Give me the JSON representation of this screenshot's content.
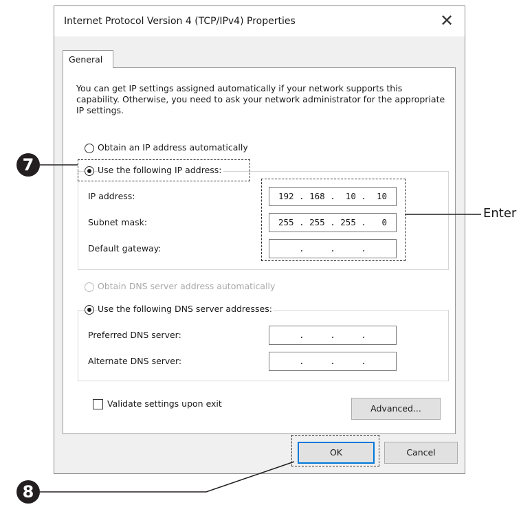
{
  "dialog": {
    "title": "Internet Protocol Version 4 (TCP/IPv4) Properties",
    "close_icon": "close-icon",
    "tab_general": "General",
    "description": "You can get IP settings assigned automatically if your network supports this capability. Otherwise, you need to ask your network administrator for the appropriate IP settings.",
    "ip_section": {
      "obtain_auto_label": "Obtain an IP address automatically",
      "use_following_label": "Use the following IP address:",
      "selected": "use_following",
      "fields": [
        {
          "label": "IP address:",
          "value": "192 . 168 .  10 .  10"
        },
        {
          "label": "Subnet mask:",
          "value": "255 . 255 . 255 .   0"
        },
        {
          "label": "Default gateway:",
          "value": ".     .     ."
        }
      ]
    },
    "dns_section": {
      "obtain_auto_label": "Obtain DNS server address automatically",
      "use_following_label": "Use the following DNS server addresses:",
      "selected": "use_following",
      "fields": [
        {
          "label": "Preferred DNS server:",
          "value": ".     .     ."
        },
        {
          "label": "Alternate DNS server:",
          "value": ".     .     ."
        }
      ]
    },
    "validate_label": "Validate settings upon exit",
    "validate_checked": false,
    "advanced_button": "Advanced...",
    "ok_button": "OK",
    "cancel_button": "Cancel"
  },
  "annotations": {
    "step7": "7",
    "step8": "8",
    "enter_label": "Enter"
  },
  "colors": {
    "focus_border": "#0078d7",
    "panel_bg": "#f0f0f0",
    "bubble": "#231f20"
  }
}
